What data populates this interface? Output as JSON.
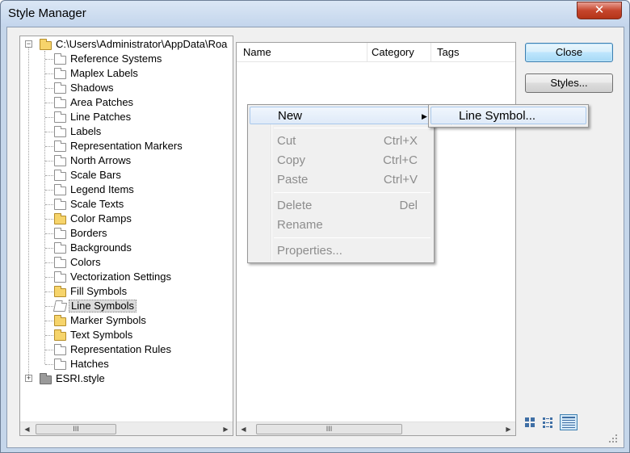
{
  "window": {
    "title": "Style Manager",
    "close_glyph": "✕"
  },
  "tree": {
    "root_label": "C:\\Users\\Administrator\\AppData\\Roa",
    "root_expander": "−",
    "items": [
      {
        "label": "Reference Systems",
        "icon": "empty-folder-icon"
      },
      {
        "label": "Maplex Labels",
        "icon": "empty-folder-icon"
      },
      {
        "label": "Shadows",
        "icon": "empty-folder-icon"
      },
      {
        "label": "Area Patches",
        "icon": "empty-folder-icon"
      },
      {
        "label": "Line Patches",
        "icon": "empty-folder-icon"
      },
      {
        "label": "Labels",
        "icon": "empty-folder-icon"
      },
      {
        "label": "Representation Markers",
        "icon": "empty-folder-icon"
      },
      {
        "label": "North Arrows",
        "icon": "empty-folder-icon"
      },
      {
        "label": "Scale Bars",
        "icon": "empty-folder-icon"
      },
      {
        "label": "Legend Items",
        "icon": "empty-folder-icon"
      },
      {
        "label": "Scale Texts",
        "icon": "empty-folder-icon"
      },
      {
        "label": "Color Ramps",
        "icon": "filled-folder-icon"
      },
      {
        "label": "Borders",
        "icon": "empty-folder-icon"
      },
      {
        "label": "Backgrounds",
        "icon": "empty-folder-icon"
      },
      {
        "label": "Colors",
        "icon": "empty-folder-icon"
      },
      {
        "label": "Vectorization Settings",
        "icon": "empty-folder-icon"
      },
      {
        "label": "Fill Symbols",
        "icon": "filled-folder-icon"
      },
      {
        "label": "Line Symbols",
        "icon": "open-folder-icon",
        "selected": true
      },
      {
        "label": "Marker Symbols",
        "icon": "filled-folder-icon"
      },
      {
        "label": "Text Symbols",
        "icon": "filled-folder-icon"
      },
      {
        "label": "Representation Rules",
        "icon": "empty-folder-icon"
      },
      {
        "label": "Hatches",
        "icon": "empty-folder-icon"
      }
    ],
    "second_root_label": "ESRI.style",
    "second_root_expander": "+"
  },
  "list": {
    "columns": [
      "Name",
      "Category",
      "Tags"
    ]
  },
  "buttons": {
    "close_label": "Close",
    "styles_label": "Styles..."
  },
  "scrollbar": {
    "left_arrow": "◀",
    "right_arrow": "▶",
    "thumb_grip": "III"
  },
  "context_menu": {
    "new_label": "New",
    "submenu_arrow": "▶",
    "items": [
      {
        "label": "Cut",
        "shortcut": "Ctrl+X"
      },
      {
        "label": "Copy",
        "shortcut": "Ctrl+C"
      },
      {
        "label": "Paste",
        "shortcut": "Ctrl+V"
      },
      {
        "label": "Delete",
        "shortcut": "Del"
      },
      {
        "label": "Rename",
        "shortcut": ""
      },
      {
        "label": "Properties...",
        "shortcut": ""
      }
    ]
  },
  "submenu": {
    "line_symbol_label": "Line Symbol..."
  },
  "view_icons": [
    "large-icons-view-icon",
    "list-view-icon",
    "details-view-icon"
  ],
  "colors": {
    "titlebar": "#c5d6ea",
    "close_button": "#c6452c",
    "selection": "#dcdcdc",
    "menu_highlight": "#dfeaf8"
  }
}
